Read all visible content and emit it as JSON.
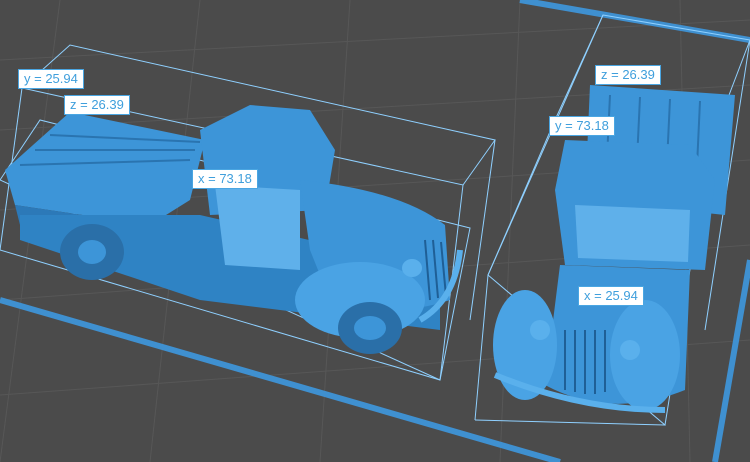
{
  "colors": {
    "background": "#4b4b4b",
    "grid_line": "#5a5a5a",
    "plate_border": "#3f90d0",
    "model": "#3d95d8",
    "model_shadow": "#1f5f96",
    "bbox": "#8fd0ff",
    "label_text": "#3f9fdc"
  },
  "models": [
    {
      "name": "side-view truck",
      "dimensions": {
        "x": "x = 73.18",
        "y": "y = 25.94",
        "z": "z = 26.39"
      }
    },
    {
      "name": "front-view truck",
      "dimensions": {
        "x": "x = 25.94",
        "y": "y = 73.18",
        "z": "z = 26.39"
      }
    }
  ]
}
